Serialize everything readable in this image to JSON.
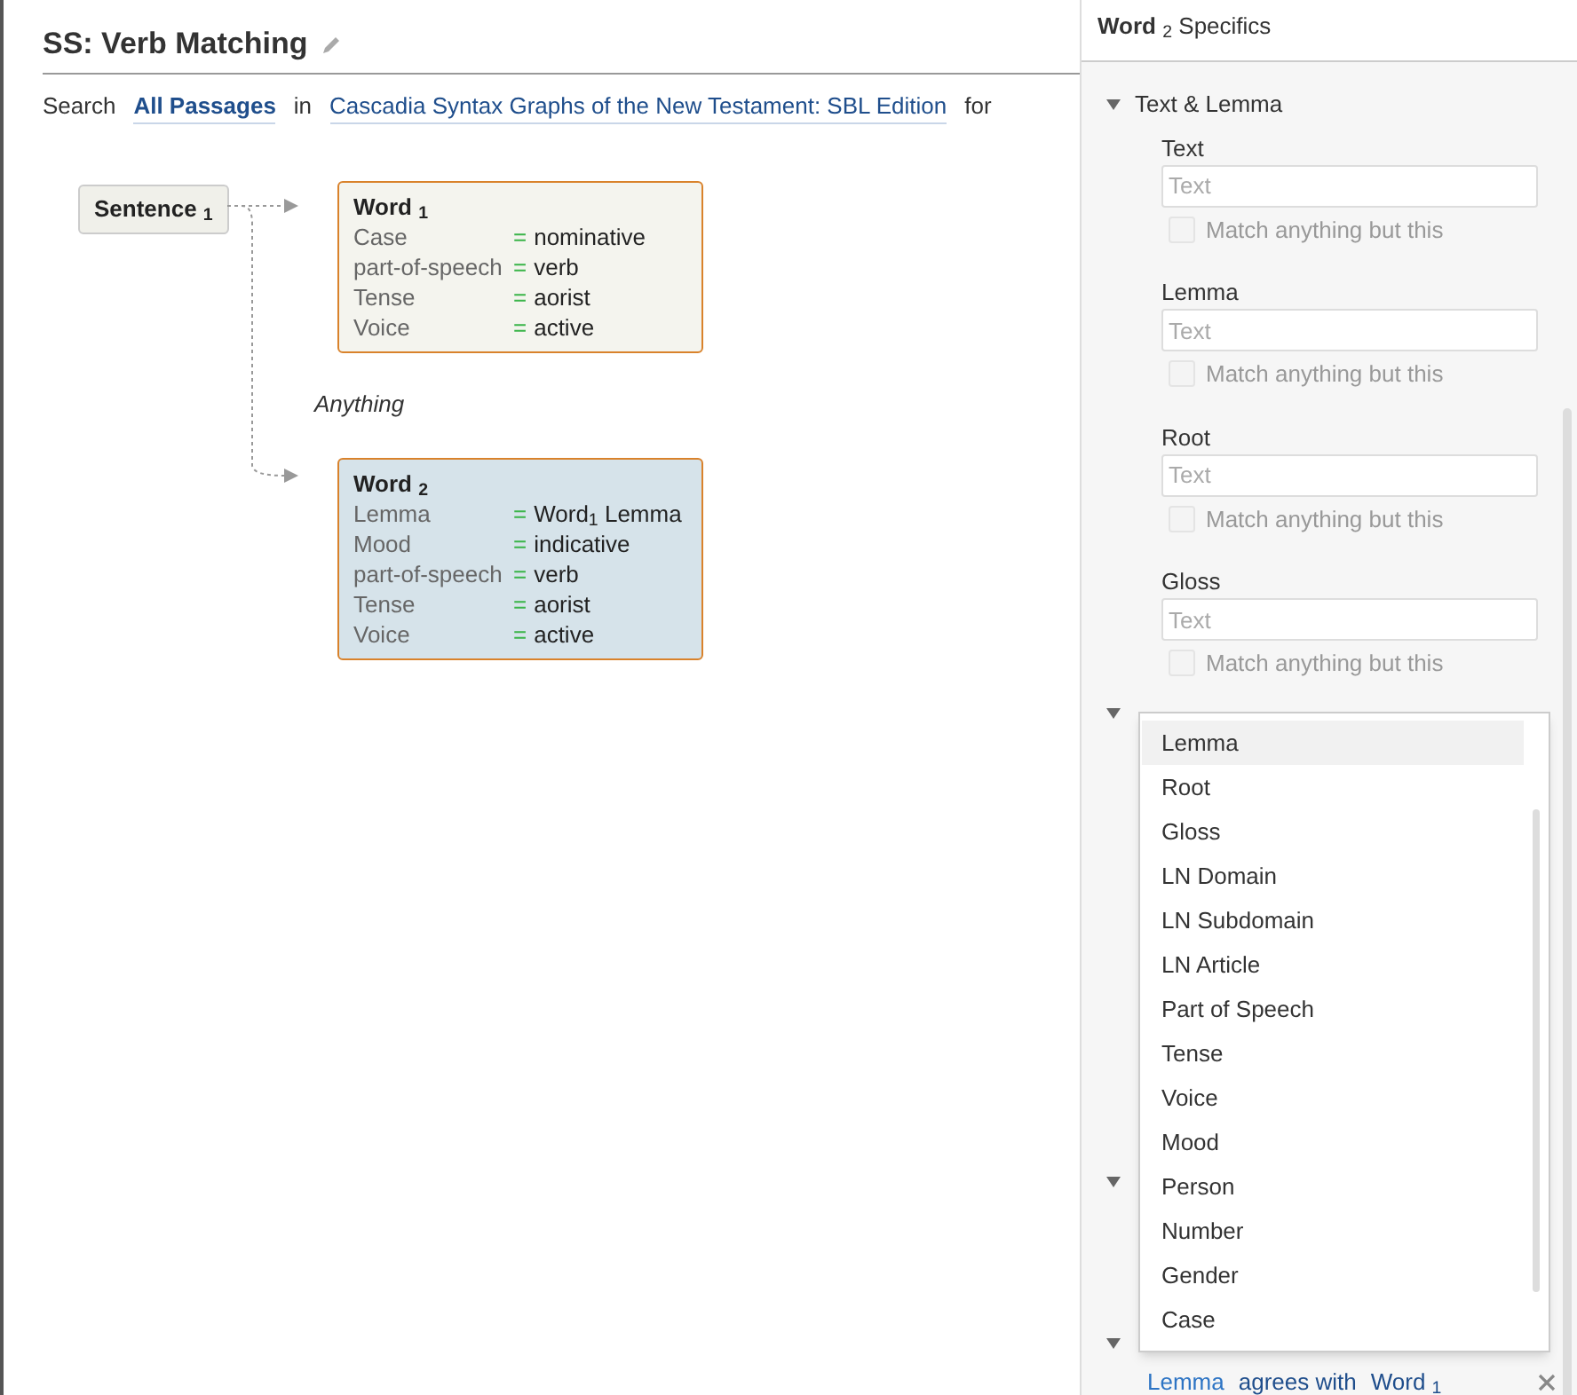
{
  "title": "SS: Verb Matching",
  "search_line": {
    "prefix": "Search",
    "scope": "All Passages",
    "middle": "in",
    "source": "Cascadia Syntax Graphs of the New Testament: SBL Edition",
    "suffix": "for"
  },
  "diagram": {
    "root": "Sentence $_{1}$",
    "nodes": [
      {
        "title": "Word $_{1}$",
        "selected": false,
        "attributes": [
          {
            "name": "Case",
            "operator": "=",
            "value": "nominative"
          },
          {
            "name": "part-of-speech",
            "operator": "=",
            "value": "verb"
          },
          {
            "name": "Tense",
            "operator": "=",
            "value": "aorist"
          },
          {
            "name": "Voice",
            "operator": "=",
            "value": "active"
          }
        ]
      },
      {
        "title": "Word $_{2}$",
        "selected": true,
        "attributes": [
          {
            "name": "Lemma",
            "operator": "=",
            "value": "Word$_{1}$ Lemma"
          },
          {
            "name": "Mood",
            "operator": "=",
            "value": "indicative"
          },
          {
            "name": "part-of-speech",
            "operator": "=",
            "value": "verb"
          },
          {
            "name": "Tense",
            "operator": "=",
            "value": "aorist"
          },
          {
            "name": "Voice",
            "operator": "=",
            "value": "active"
          }
        ]
      }
    ],
    "gap_label": "Anything"
  },
  "panel": {
    "title": "Word $_{2}$ Specifics",
    "section": {
      "title": "Text & Lemma",
      "expanded": true,
      "fields": [
        {
          "label": "Text",
          "placeholder": "Text",
          "negate_label": "Match anything but this",
          "negate": false
        },
        {
          "label": "Lemma",
          "placeholder": "Text",
          "negate_label": "Match anything but this",
          "negate": false
        },
        {
          "label": "Root",
          "placeholder": "Text",
          "negate_label": "Match anything but this",
          "negate": false
        },
        {
          "label": "Gloss",
          "placeholder": "Text",
          "negate_label": "Match anything but this",
          "negate": false
        }
      ]
    },
    "agreement": {
      "property": "Lemma",
      "relation": "agrees with",
      "target": "Word $_{1}$"
    }
  },
  "dropdown": {
    "items": [
      {
        "label": "Lemma",
        "selected": true
      },
      {
        "label": "Root",
        "selected": false
      },
      {
        "label": "Gloss",
        "selected": false
      },
      {
        "label": "LN Domain",
        "selected": false
      },
      {
        "label": "LN Subdomain",
        "selected": false
      },
      {
        "label": "LN Article",
        "selected": false
      },
      {
        "label": "Part of Speech",
        "selected": false
      },
      {
        "label": "Tense",
        "selected": false
      },
      {
        "label": "Voice",
        "selected": false
      },
      {
        "label": "Mood",
        "selected": false
      },
      {
        "label": "Person",
        "selected": false
      },
      {
        "label": "Number",
        "selected": false
      },
      {
        "label": "Gender",
        "selected": false
      },
      {
        "label": "Case",
        "selected": false
      }
    ]
  }
}
